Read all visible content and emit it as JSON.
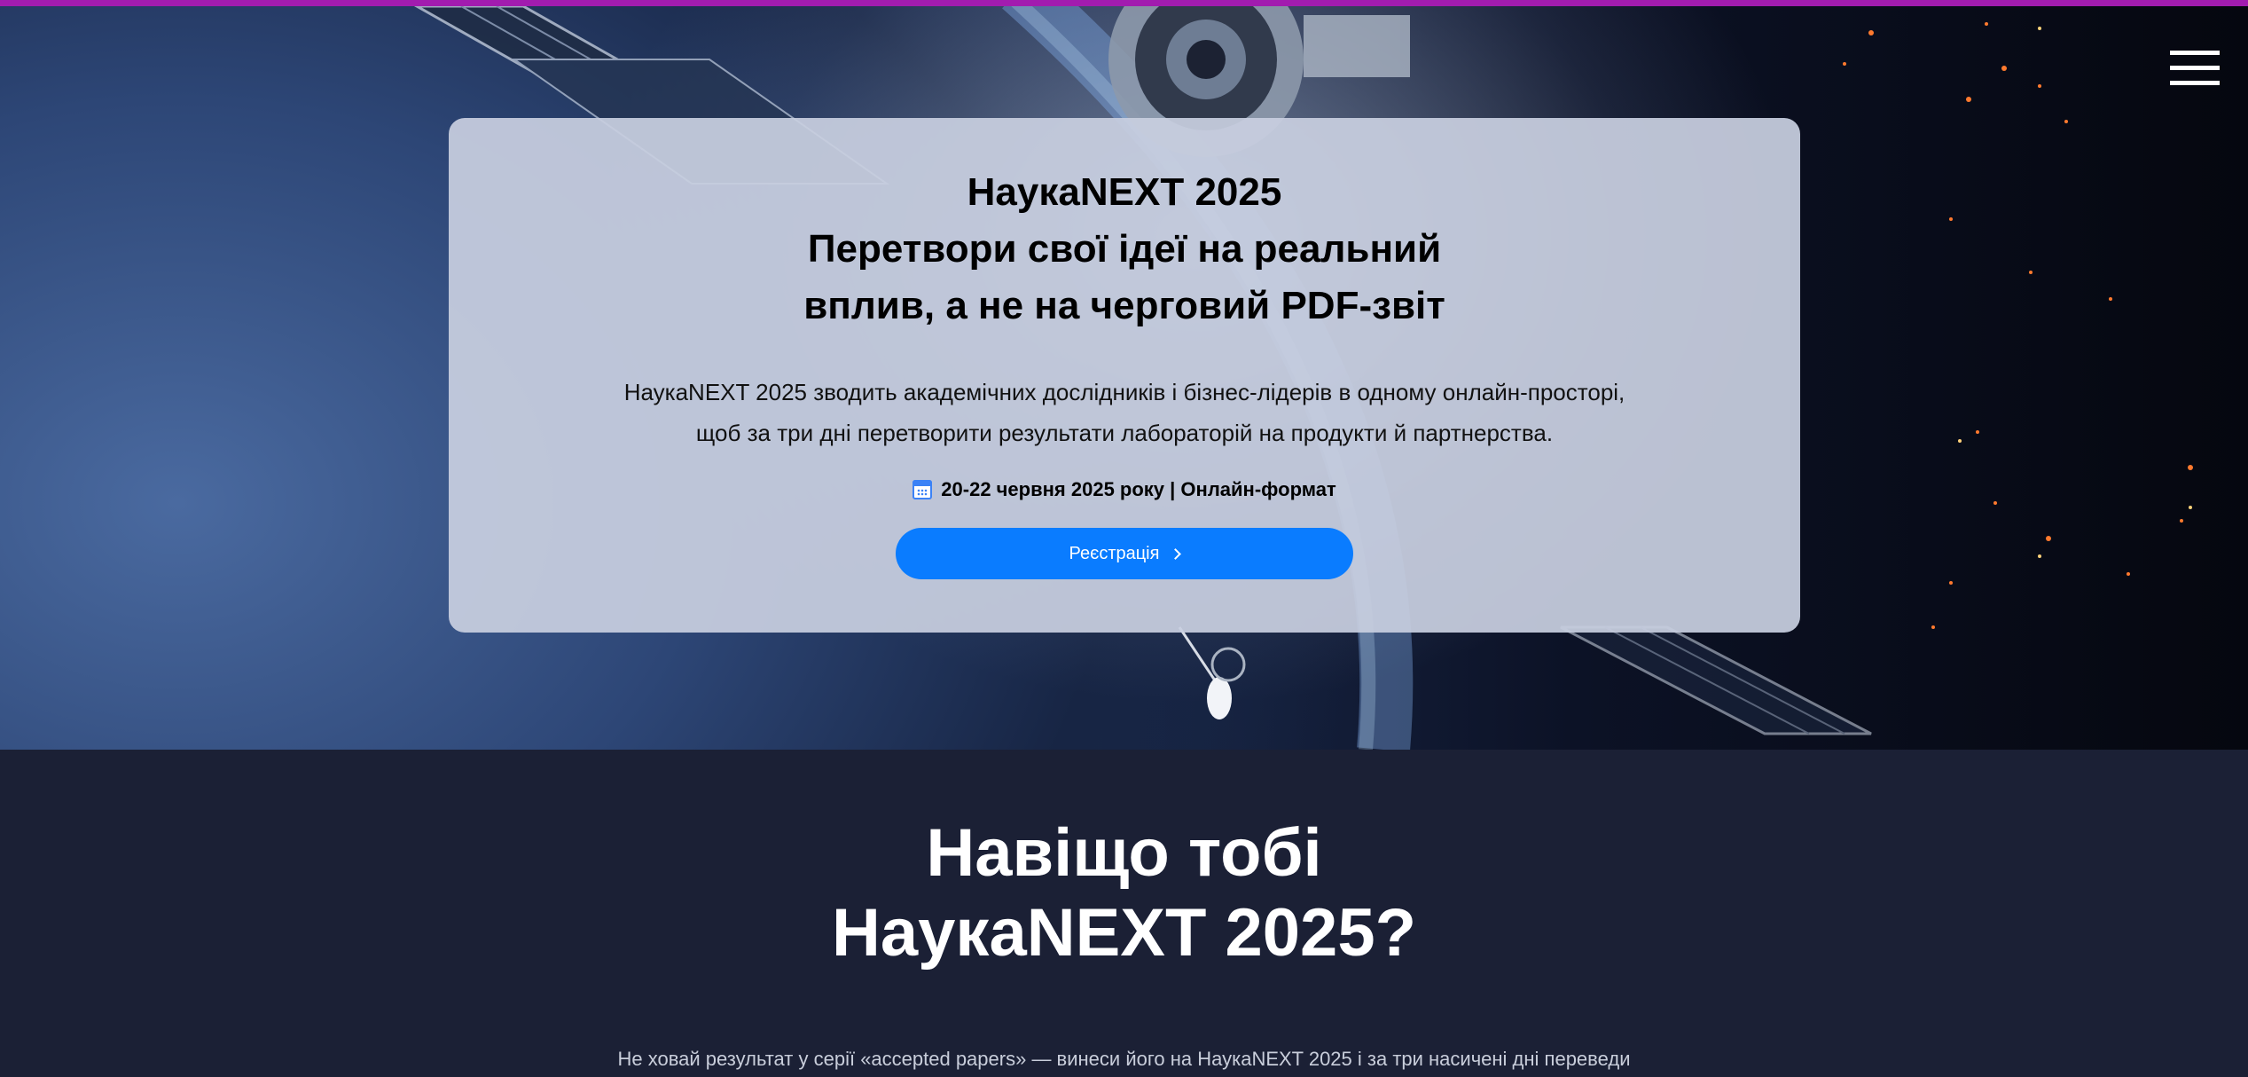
{
  "hero": {
    "menu_icon": "hamburger-menu-icon",
    "title_line1": "НаукаNEXT 2025",
    "title_line2": "Перетвори свої ідеї на реальний",
    "title_line3": "вплив, а не на черговий PDF-звіт",
    "desc_line1": "НаукаNEXT 2025 зводить академічних дослідників і бізнес-лідерів в одному онлайн-просторі,",
    "desc_line2": "щоб за три дні перетворити результати лабораторій на продукти й партнерства.",
    "date_icon": "calendar-icon",
    "date_text": "20-22 червня 2025 року | Онлайн-формат",
    "register_label": "Реєстрація",
    "register_icon": "chevron-right-icon"
  },
  "why": {
    "title_line1": "Навіщо тобі",
    "title_line2": "НаукаNEXT 2025?",
    "text": "Не ховай результат у серії «accepted papers» — винеси його на НаукаNEXT 2025 і за три насичені дні переведи"
  },
  "colors": {
    "accent_top": "#a21caf",
    "button": "#0a7cff",
    "card": "#c8cfe0",
    "section_bg": "#1b2035"
  }
}
